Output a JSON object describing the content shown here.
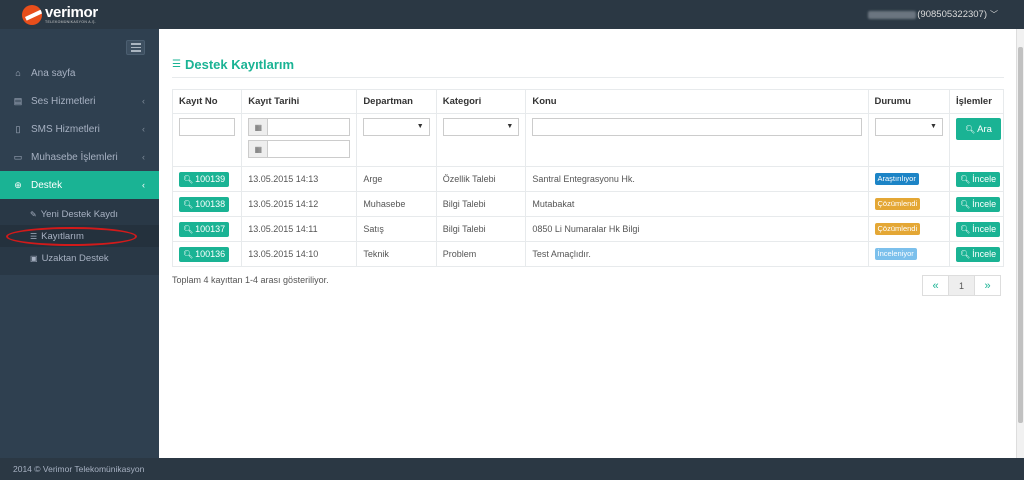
{
  "header": {
    "logo_text": "verimor",
    "logo_subtext": "TELEKOMÜNİKASYON A.Ş.",
    "user_text": "(908505322307)"
  },
  "sidebar": {
    "items": [
      {
        "label": "Ana sayfa",
        "icon": "home-icon"
      },
      {
        "label": "Ses Hizmetleri",
        "icon": "phone-icon"
      },
      {
        "label": "SMS Hizmetleri",
        "icon": "mobile-icon"
      },
      {
        "label": "Muhasebe İşlemleri",
        "icon": "money-icon"
      },
      {
        "label": "Destek",
        "icon": "globe-icon"
      }
    ],
    "subitems": [
      {
        "label": "Yeni Destek Kaydı",
        "icon": "edit-icon"
      },
      {
        "label": "Kayıtlarım",
        "icon": "list-icon"
      },
      {
        "label": "Uzaktan Destek",
        "icon": "briefcase-icon"
      }
    ]
  },
  "page": {
    "title": "Destek Kayıtlarım"
  },
  "table": {
    "headers": [
      "Kayıt No",
      "Kayıt Tarihi",
      "Departman",
      "Kategori",
      "Konu",
      "Durumu",
      "İşlemler"
    ],
    "search_label": "Ara",
    "view_label": "İncele",
    "rows": [
      {
        "id": "100139",
        "date": "13.05.2015 14:13",
        "department": "Arge",
        "category": "Özellik Talebi",
        "subject": "Santral Entegrasyonu Hk.",
        "status": "Araştırılıyor",
        "status_color": "#1c84c6"
      },
      {
        "id": "100138",
        "date": "13.05.2015 14:12",
        "department": "Muhasebe",
        "category": "Bilgi Talebi",
        "subject": "Mutabakat",
        "status": "Çözümlendi",
        "status_color": "#e4a735"
      },
      {
        "id": "100137",
        "date": "13.05.2015 14:11",
        "department": "Satış",
        "category": "Bilgi Talebi",
        "subject": "0850 Li Numaralar Hk Bilgi",
        "status": "Çözümlendi",
        "status_color": "#e4a735"
      },
      {
        "id": "100136",
        "date": "13.05.2015 14:10",
        "department": "Teknik",
        "category": "Problem",
        "subject": "Test Amaçlıdır.",
        "status": "İnceleniyor",
        "status_color": "#7cc0ec"
      }
    ]
  },
  "summary_text": "Toplam 4 kayıttan 1-4 arası gösteriliyor.",
  "pagination": {
    "prev": "«",
    "current": "1",
    "next": "»"
  },
  "footer_text": "2014 © Verimor Telekomünikasyon",
  "colors": {
    "accent": "#1ab394",
    "sidebar": "#2f4050",
    "annotation": "#d21a1a"
  }
}
